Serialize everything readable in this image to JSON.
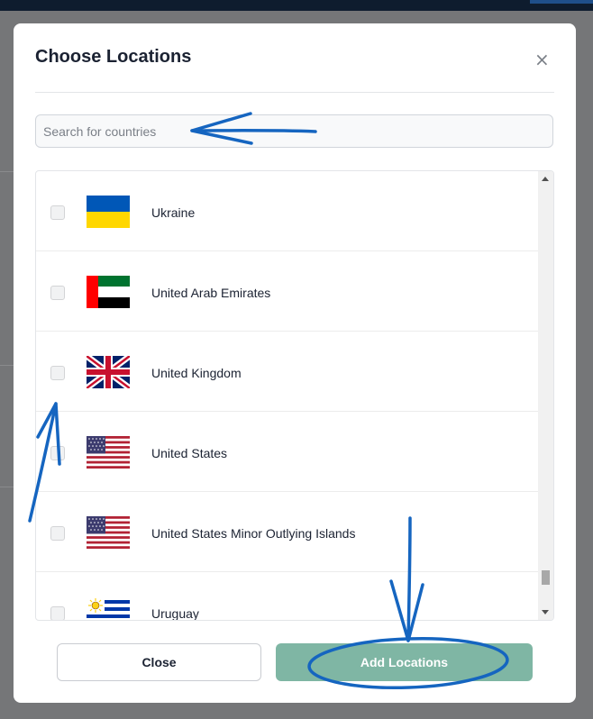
{
  "modal": {
    "title": "Choose Locations",
    "close_symbol": "×",
    "search_placeholder": "Search for countries"
  },
  "countries": [
    {
      "name": "Ukraine",
      "flag": "ukraine-flag-icon"
    },
    {
      "name": "United Arab Emirates",
      "flag": "uae-flag-icon"
    },
    {
      "name": "United Kingdom",
      "flag": "uk-flag-icon"
    },
    {
      "name": "United States",
      "flag": "us-flag-icon"
    },
    {
      "name": "United States Minor Outlying Islands",
      "flag": "us-flag-icon"
    },
    {
      "name": "Uruguay",
      "flag": "uruguay-flag-icon"
    }
  ],
  "buttons": {
    "close": "Close",
    "add": "Add Locations"
  },
  "colors": {
    "accent_button": "#7fb6a4",
    "annotation_blue": "#1565c0",
    "title_text": "#1b2232"
  }
}
